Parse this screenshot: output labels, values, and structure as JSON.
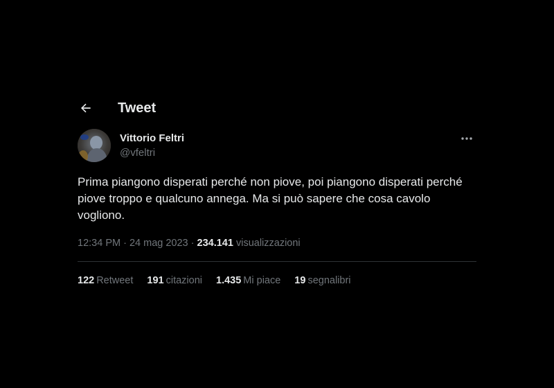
{
  "header": {
    "title": "Tweet",
    "back_icon": "arrow-left-icon"
  },
  "author": {
    "display_name": "Vittorio Feltri",
    "handle": "@vfeltri",
    "avatar_icon": "profile-photo",
    "more_icon": "more-horizontal-icon"
  },
  "tweet": {
    "text": "Prima piangono disperati perché non piove, poi piangono disperati perché piove troppo e qualcuno annega. Ma si può sapere che cosa cavolo vogliono."
  },
  "meta": {
    "time": "12:34 PM",
    "separator1": " · ",
    "date": "24 mag 2023",
    "separator2": " · ",
    "views_count": "234.141",
    "views_label": "visualizzazioni"
  },
  "stats": [
    {
      "count": "122",
      "label": "Retweet"
    },
    {
      "count": "191",
      "label": "citazioni"
    },
    {
      "count": "1.435",
      "label": "Mi piace"
    },
    {
      "count": "19",
      "label": "segnalibri"
    }
  ],
  "colors": {
    "background": "#000000",
    "text_primary": "#e7e9ea",
    "text_secondary": "#71767b",
    "divider": "#2f3336"
  }
}
